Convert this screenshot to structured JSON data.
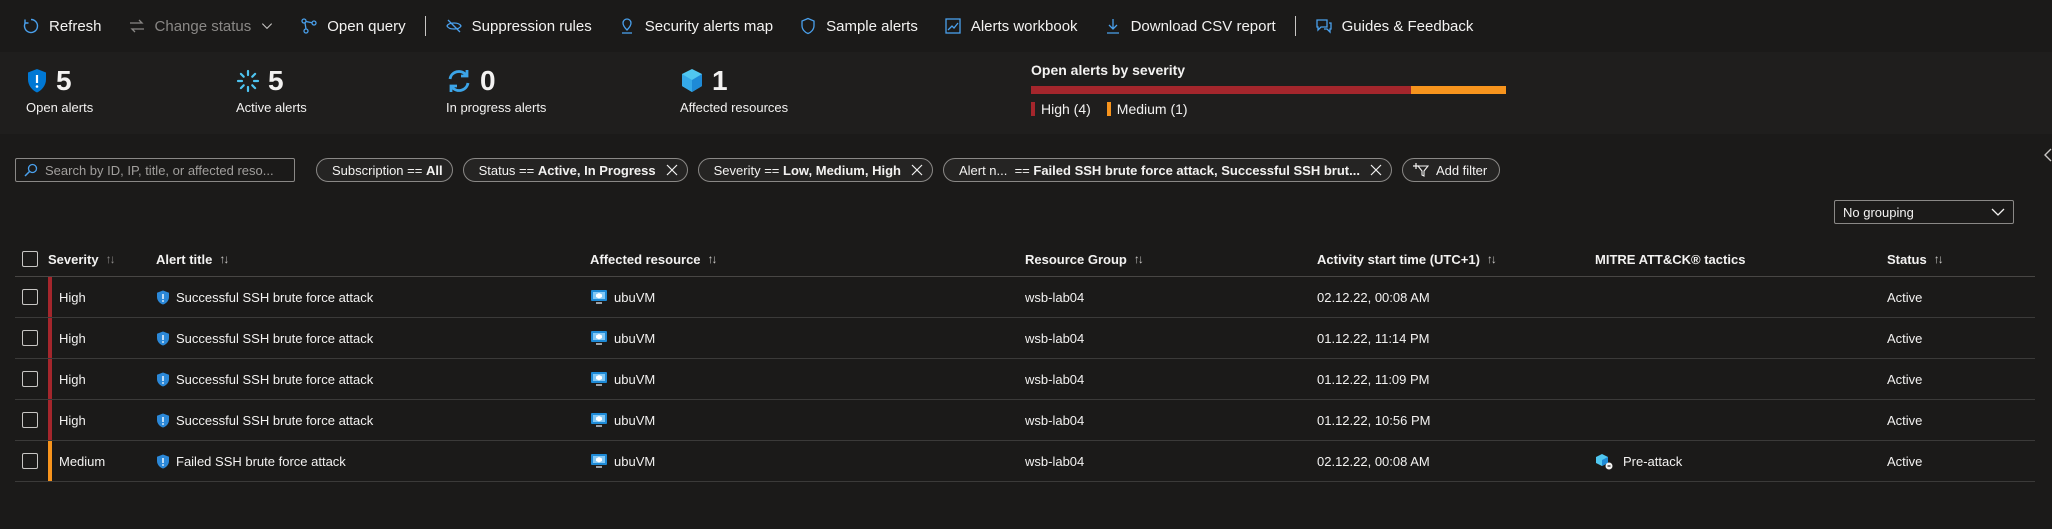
{
  "toolbar": {
    "refresh": "Refresh",
    "change_status": "Change status",
    "open_query": "Open query",
    "suppression_rules": "Suppression rules",
    "security_alerts_map": "Security alerts map",
    "sample_alerts": "Sample alerts",
    "alerts_workbook": "Alerts workbook",
    "download_csv": "Download CSV report",
    "guides_feedback": "Guides & Feedback"
  },
  "summary": {
    "open_alerts": {
      "value": "5",
      "label": "Open alerts"
    },
    "active_alerts": {
      "value": "5",
      "label": "Active alerts"
    },
    "in_progress": {
      "value": "0",
      "label": "In progress alerts"
    },
    "affected_resources": {
      "value": "1",
      "label": "Affected resources"
    },
    "severity": {
      "title": "Open alerts by severity",
      "high": {
        "label": "High (4)",
        "count": 4,
        "color": "#a4262c"
      },
      "medium": {
        "label": "Medium (1)",
        "count": 1,
        "color": "#f7941d"
      }
    }
  },
  "filters": {
    "search_placeholder": "Search by ID, IP, title, or affected reso...",
    "pills": [
      {
        "key": "Subscription == ",
        "value": "All",
        "removable": false
      },
      {
        "key": "Status == ",
        "value": "Active, In Progress",
        "removable": true
      },
      {
        "key": "Severity == ",
        "value": "Low, Medium, High",
        "removable": true
      },
      {
        "key": "Alert n...  == ",
        "value": "Failed SSH brute force attack, Successful SSH brut...",
        "removable": true
      }
    ],
    "add_filter": "Add filter"
  },
  "grouping": {
    "value": "No grouping"
  },
  "table": {
    "columns": {
      "severity": "Severity",
      "alert_title": "Alert title",
      "affected_resource": "Affected resource",
      "resource_group": "Resource Group",
      "activity_start": "Activity start time (UTC+1)",
      "mitre": "MITRE ATT&CK® tactics",
      "status": "Status"
    },
    "sort_glyph": "↑↓",
    "rows": [
      {
        "severity": "High",
        "severity_color": "#a4262c",
        "title": "Successful SSH brute force attack",
        "resource": "ubuVM",
        "group": "wsb-lab04",
        "time": "02.12.22, 00:08 AM",
        "tactic": "",
        "status": "Active"
      },
      {
        "severity": "High",
        "severity_color": "#a4262c",
        "title": "Successful SSH brute force attack",
        "resource": "ubuVM",
        "group": "wsb-lab04",
        "time": "01.12.22, 11:14 PM",
        "tactic": "",
        "status": "Active"
      },
      {
        "severity": "High",
        "severity_color": "#a4262c",
        "title": "Successful SSH brute force attack",
        "resource": "ubuVM",
        "group": "wsb-lab04",
        "time": "01.12.22, 11:09 PM",
        "tactic": "",
        "status": "Active"
      },
      {
        "severity": "High",
        "severity_color": "#a4262c",
        "title": "Successful SSH brute force attack",
        "resource": "ubuVM",
        "group": "wsb-lab04",
        "time": "01.12.22, 10:56 PM",
        "tactic": "",
        "status": "Active"
      },
      {
        "severity": "Medium",
        "severity_color": "#f7941d",
        "title": "Failed SSH brute force attack",
        "resource": "ubuVM",
        "group": "wsb-lab04",
        "time": "02.12.22, 00:08 AM",
        "tactic": "Pre-attack",
        "status": "Active"
      }
    ]
  }
}
